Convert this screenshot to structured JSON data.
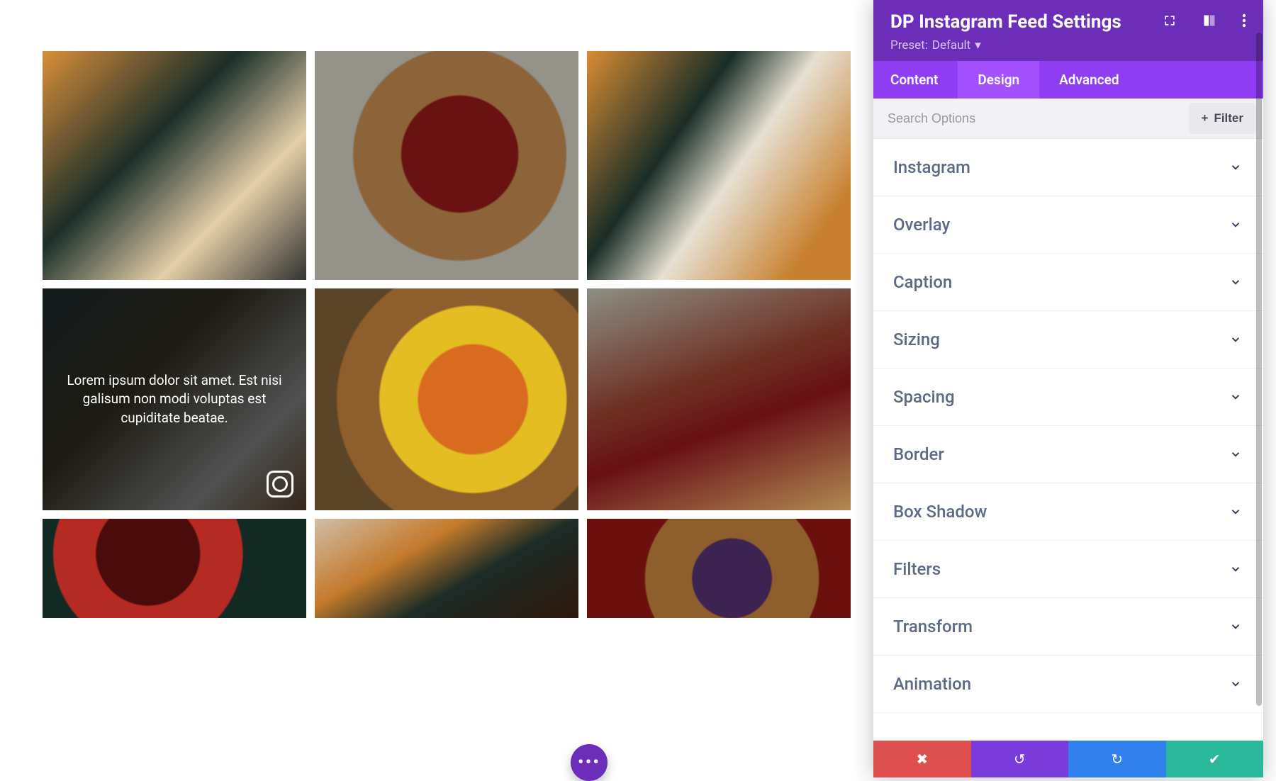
{
  "feed": {
    "overlay_caption": "Lorem ipsum dolor sit amet. Est nisi galisum non modi voluptas est cupiditate beatae."
  },
  "panel": {
    "title": "DP Instagram Feed Settings",
    "preset_label": "Preset:",
    "preset_value": "Default",
    "tabs": {
      "content": "Content",
      "design": "Design",
      "advanced": "Advanced"
    },
    "search_placeholder": "Search Options",
    "filter_label": "Filter",
    "sections": [
      "Instagram",
      "Overlay",
      "Caption",
      "Sizing",
      "Spacing",
      "Border",
      "Box Shadow",
      "Filters",
      "Transform",
      "Animation"
    ],
    "credit": ""
  }
}
